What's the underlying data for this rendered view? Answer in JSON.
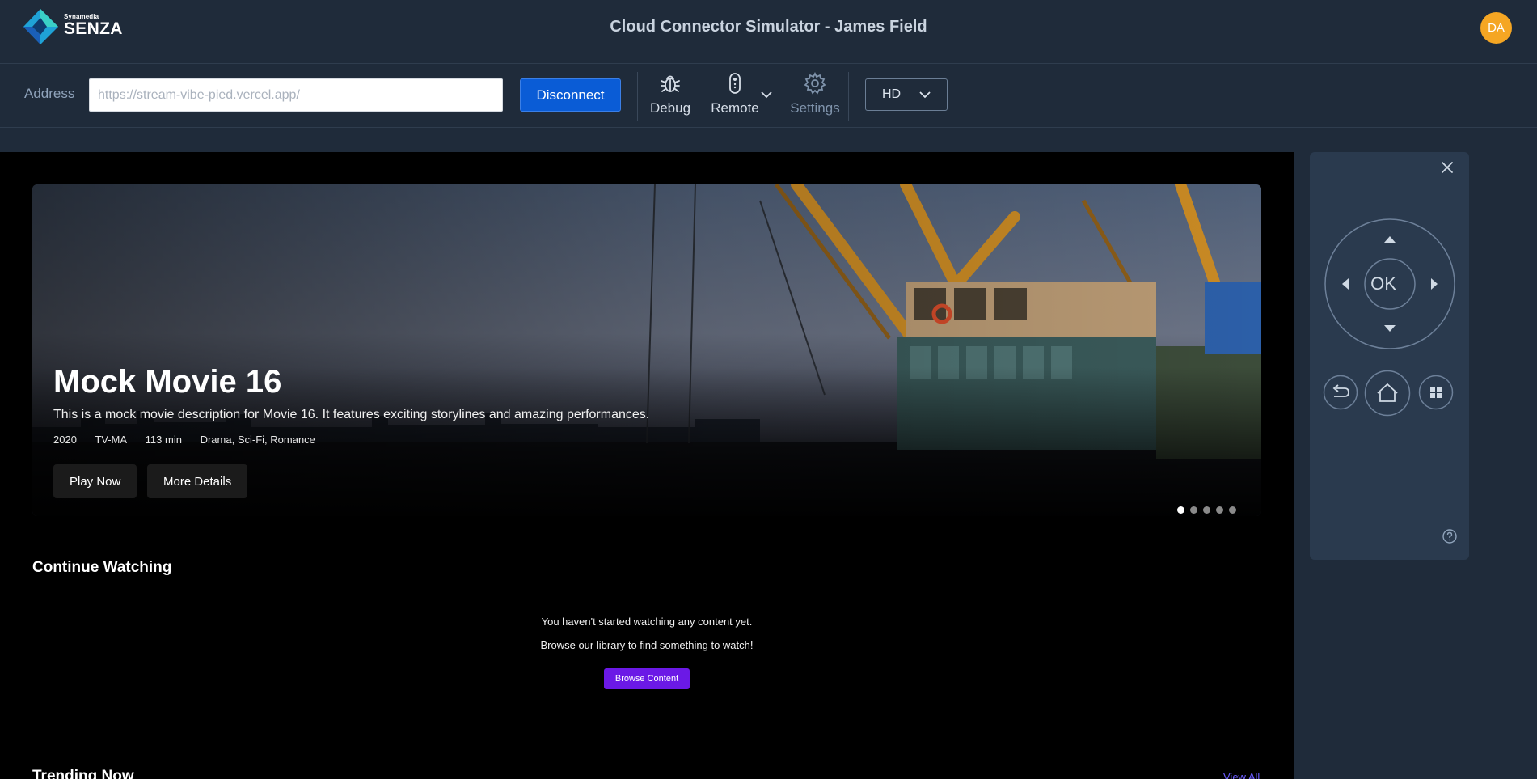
{
  "header": {
    "brand_small": "Synamedia",
    "brand_name": "SENZA",
    "title": "Cloud Connector Simulator - James Field",
    "avatar_initials": "DA"
  },
  "toolbar": {
    "address_label": "Address",
    "address_placeholder": "https://stream-vibe-pied.vercel.app/",
    "disconnect_label": "Disconnect",
    "debug_label": "Debug",
    "remote_label": "Remote",
    "settings_label": "Settings",
    "resolution_value": "HD"
  },
  "hero": {
    "title": "Mock Movie 16",
    "description": "This is a mock movie description for Movie 16. It features exciting storylines and amazing performances.",
    "year": "2020",
    "rating": "TV-MA",
    "duration": "113 min",
    "genres": "Drama, Sci-Fi, Romance",
    "play_label": "Play Now",
    "details_label": "More Details",
    "slide_count": 5,
    "active_slide": 1
  },
  "continue_watching": {
    "title": "Continue Watching",
    "empty_line1": "You haven't started watching any content yet.",
    "empty_line2": "Browse our library to find something to watch!",
    "browse_label": "Browse Content"
  },
  "trending": {
    "title": "Trending Now",
    "view_all_label": "View All"
  },
  "remote_panel": {
    "ok_label": "OK"
  },
  "colors": {
    "chrome_bg": "#1f2b3a",
    "accent_blue": "#0a5cd6",
    "avatar_orange": "#f5a623",
    "browse_purple": "#6b19e6",
    "remote_bg": "#2a3a4e"
  }
}
